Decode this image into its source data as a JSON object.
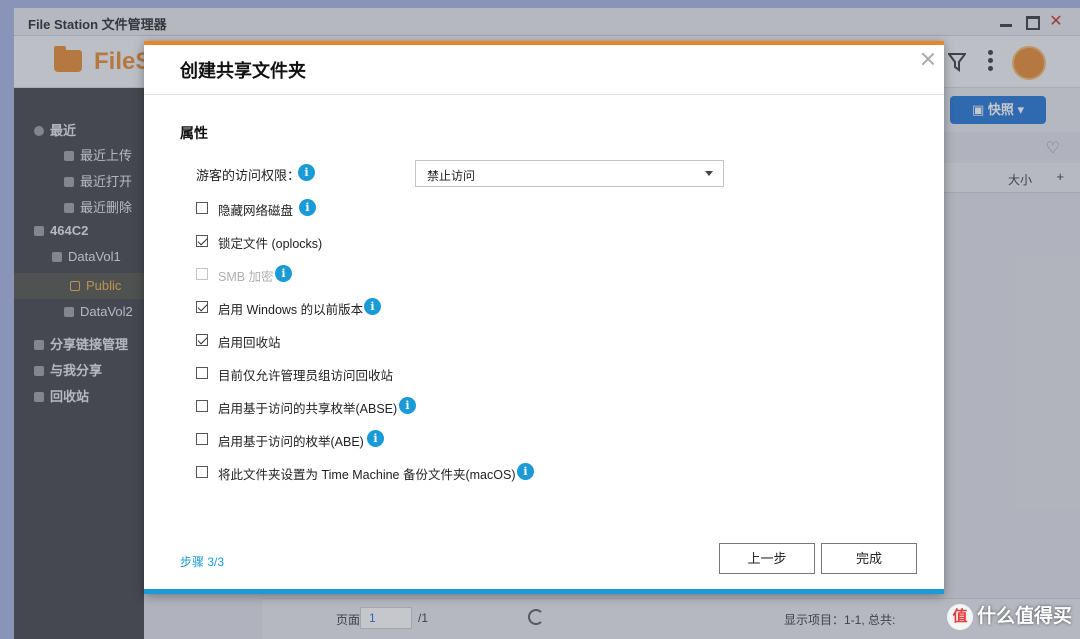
{
  "window": {
    "title": "File Station 文件管理器",
    "app_name": "FileS"
  },
  "sidebar": {
    "items": [
      {
        "label": "最近"
      },
      {
        "label": "最近上传"
      },
      {
        "label": "最近打开"
      },
      {
        "label": "最近删除"
      },
      {
        "label": "464C2"
      },
      {
        "label": "DataVol1"
      },
      {
        "label": "Public"
      },
      {
        "label": "DataVol2"
      },
      {
        "label": "分享链接管理"
      },
      {
        "label": "与我分享"
      },
      {
        "label": "回收站"
      }
    ]
  },
  "toolbar": {
    "snapshot_label": "快照"
  },
  "list": {
    "size_header": "大小",
    "plus": "+"
  },
  "statusbar": {
    "page_label": "页面",
    "page_value": "1",
    "total_pages": "/1",
    "display_items": "显示项目：1-1, 总共:"
  },
  "modal": {
    "title": "创建共享文件夹",
    "section_title": "属性",
    "guest_access_label": "游客的访问权限：",
    "guest_access_value": "禁止访问",
    "options": [
      {
        "label": "隐藏网络磁盘",
        "checked": false,
        "disabled": false,
        "info": true
      },
      {
        "label": "锁定文件 (oplocks)",
        "checked": true,
        "disabled": false,
        "info": false
      },
      {
        "label": "SMB 加密",
        "checked": false,
        "disabled": true,
        "info": true
      },
      {
        "label": "启用 Windows 的以前版本",
        "checked": true,
        "disabled": false,
        "info": true
      },
      {
        "label": "启用回收站",
        "checked": true,
        "disabled": false,
        "info": false
      },
      {
        "label": "目前仅允许管理员组访问回收站",
        "checked": false,
        "disabled": false,
        "info": false
      },
      {
        "label": "启用基于访问的共享枚举(ABSE)",
        "checked": false,
        "disabled": false,
        "info": true
      },
      {
        "label": "启用基于访问的枚举(ABE)",
        "checked": false,
        "disabled": false,
        "info": true
      },
      {
        "label": "将此文件夹设置为 Time Machine 备份文件夹(macOS)",
        "checked": false,
        "disabled": false,
        "info": true
      }
    ],
    "step": "步骤 3/3",
    "prev_label": "上一步",
    "done_label": "完成"
  },
  "watermark": {
    "badge": "值",
    "text": "什么值得买"
  },
  "colors": {
    "accent_orange": "#e8862a",
    "info_blue": "#1a9ad6",
    "snapshot_blue": "#1a6fd4"
  }
}
